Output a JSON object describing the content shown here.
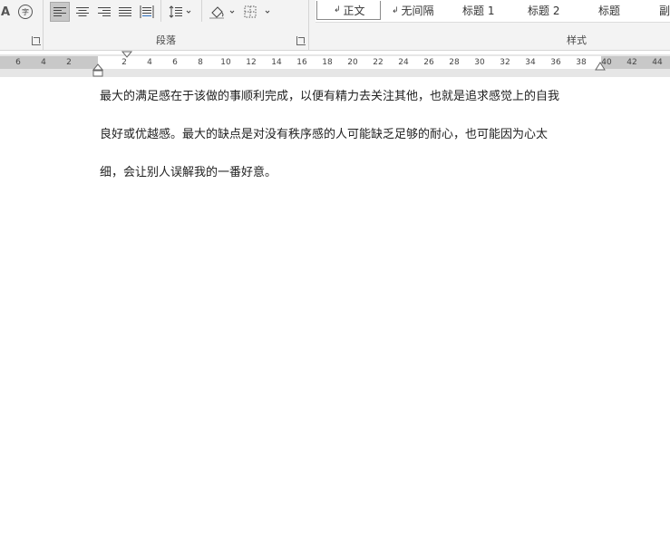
{
  "ribbon": {
    "paragraph_group_label": "段落",
    "styles_group_label": "样式",
    "font_glyph_a": "A",
    "phonetic_glyph": "字",
    "styles": [
      {
        "label": "正文",
        "mark": "↲",
        "selected": true
      },
      {
        "label": "无间隔",
        "mark": "↲",
        "selected": false
      },
      {
        "label": "标题 1",
        "mark": "",
        "selected": false
      },
      {
        "label": "标题 2",
        "mark": "",
        "selected": false
      },
      {
        "label": "标题",
        "mark": "",
        "selected": false
      },
      {
        "label": "副",
        "mark": "",
        "selected": false
      }
    ],
    "icons": [
      "font-color-icon",
      "phonetic-guide-icon",
      "align-left-icon",
      "align-center-icon",
      "align-right-icon",
      "justify-icon",
      "distributed-icon",
      "line-spacing-icon",
      "shading-icon",
      "borders-icon",
      "dialog-launcher-icon"
    ]
  },
  "ruler": {
    "left_numbers": [
      "6",
      "4",
      "2"
    ],
    "right_numbers": [
      "2",
      "4",
      "6",
      "8",
      "10",
      "12",
      "14",
      "16",
      "18",
      "20",
      "22",
      "24",
      "26",
      "28",
      "30",
      "32",
      "34",
      "36",
      "38",
      "40",
      "42",
      "44"
    ]
  },
  "document": {
    "lines": [
      "最大的满足感在于该做的事顺利完成，以便有精力去关注其他，也就是追求感觉上的自我",
      "良好或优越感。最大的缺点是对没有秩序感的人可能缺乏足够的耐心，也可能因为心太",
      "细，会让别人误解我的一番好意。"
    ]
  },
  "colors": {
    "ribbon_bg": "#f3f3f3",
    "active_button": "#c7c7c7",
    "ruler_margin": "#c8c8c8",
    "page": "#ffffff"
  }
}
